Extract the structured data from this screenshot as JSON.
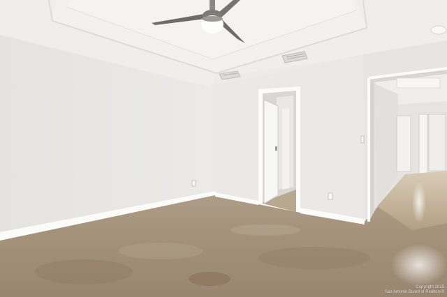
{
  "photo": {
    "scene": "empty-room-interior",
    "watermark": {
      "line1": "Copyright 2025",
      "line2": "San Antonio Board of Realtors®"
    }
  },
  "colors": {
    "wall": "#e8e7e4",
    "ceiling": "#f0efec",
    "floor": "#a08f78",
    "trim": "#fbfbfa",
    "fan_blade": "#6e6b68"
  }
}
